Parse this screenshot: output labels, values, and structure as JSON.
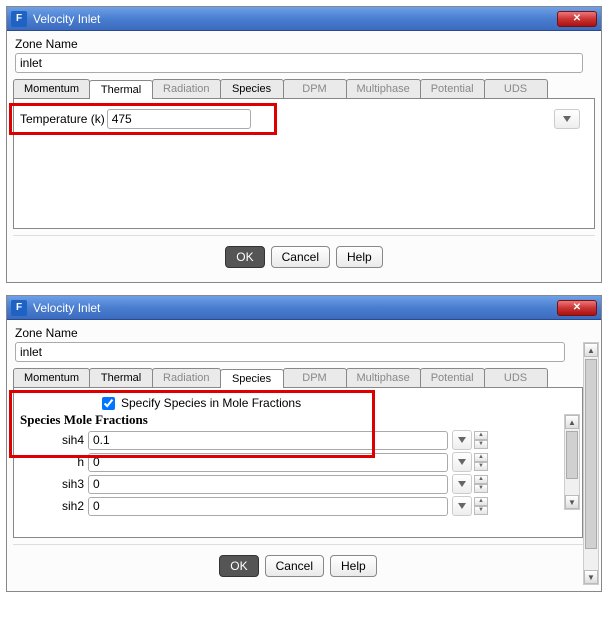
{
  "dialogs": [
    {
      "title": "Velocity Inlet",
      "zone_label": "Zone Name",
      "zone_value": "inlet",
      "active_tab": "Thermal",
      "tabs": [
        "Momentum",
        "Thermal",
        "Radiation",
        "Species",
        "DPM",
        "Multiphase",
        "Potential",
        "UDS"
      ],
      "thermal": {
        "label": "Temperature (k)",
        "value": "475"
      },
      "buttons": {
        "ok": "OK",
        "cancel": "Cancel",
        "help": "Help"
      }
    },
    {
      "title": "Velocity Inlet",
      "zone_label": "Zone Name",
      "zone_value": "inlet",
      "active_tab": "Species",
      "tabs": [
        "Momentum",
        "Thermal",
        "Radiation",
        "Species",
        "DPM",
        "Multiphase",
        "Potential",
        "UDS"
      ],
      "species": {
        "check_label": "Specify Species in Mole Fractions",
        "checked": true,
        "header": "Species Mole Fractions",
        "rows": [
          {
            "name": "sih4",
            "value": "0.1"
          },
          {
            "name": "h",
            "value": "0"
          },
          {
            "name": "sih3",
            "value": "0"
          },
          {
            "name": "sih2",
            "value": "0"
          }
        ]
      },
      "buttons": {
        "ok": "OK",
        "cancel": "Cancel",
        "help": "Help"
      }
    }
  ]
}
